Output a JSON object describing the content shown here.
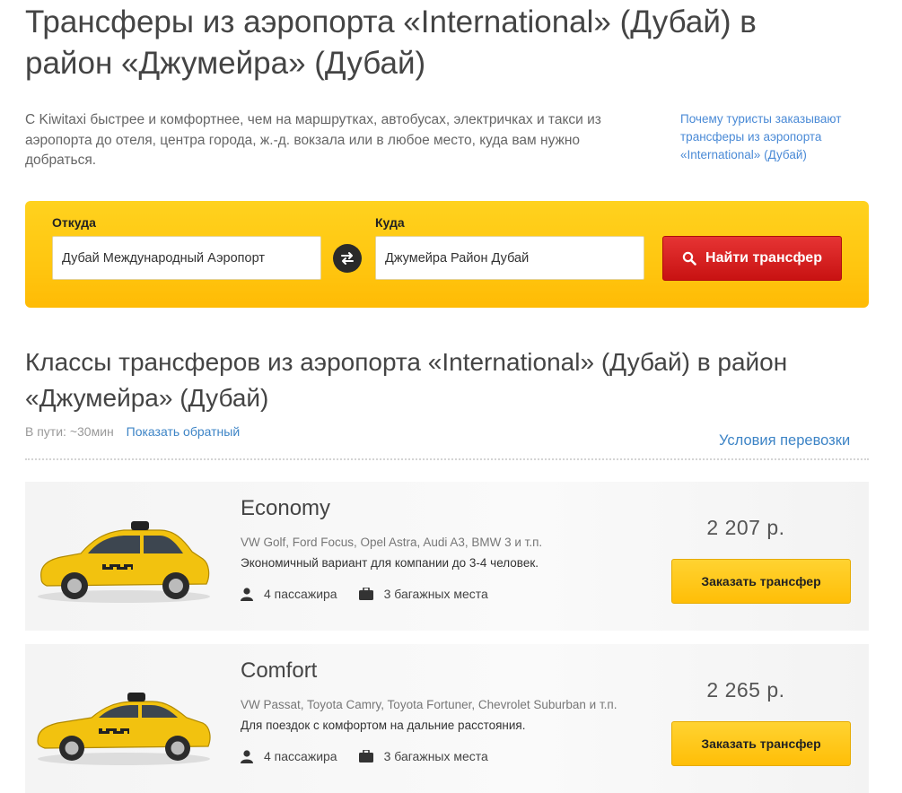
{
  "page": {
    "title": "Трансферы из аэропорта «International» (Дубай) в район «Джумейра» (Дубай)",
    "intro": "С Kiwitaxi быстрее и комфортнее, чем на маршрутках, автобусах, электричках и такси из аэропорта до отеля, центра города, ж.-д. вокзала или в любое место, куда вам нужно добраться.",
    "why_link": "Почему туристы заказывают трансферы из аэропорта «International» (Дубай)"
  },
  "search": {
    "from_label": "Откуда",
    "from_value": "Дубай Международный Аэропорт",
    "to_label": "Куда",
    "to_value": "Джумейра Район Дубай",
    "button_label": "Найти трансфер",
    "swap_icon": "swap-arrows-icon",
    "search_icon": "search-icon",
    "panel_color": "#ffc610",
    "button_color": "#d41f1f"
  },
  "classes_section": {
    "title": "Классы трансферов из аэропорта «International» (Дубай) в район «Джумейра» (Дубай)",
    "travel_time": "В пути: ~30мин",
    "reverse_link": "Показать обратный",
    "conditions_link": "Условия перевозки"
  },
  "classes": [
    {
      "name": "Economy",
      "models": "VW Golf, Ford Focus, Opel Astra, Audi A3, BMW 3 и т.п.",
      "description": "Экономичный вариант для компании до 3-4 человек.",
      "passengers": "4 пассажира",
      "luggage": "3 багажных места",
      "price": "2 207  р.",
      "button": "Заказать трансфер",
      "car_icon": "hatchback-taxi-image"
    },
    {
      "name": "Comfort",
      "models": "VW Passat, Toyota Camry, Toyota Fortuner, Chevrolet Suburban и т.п.",
      "description": "Для поездок с комфортом на дальние расстояния.",
      "passengers": "4 пассажира",
      "luggage": "3 багажных места",
      "price": "2 265  р.",
      "button": "Заказать трансфер",
      "car_icon": "sedan-taxi-image"
    }
  ],
  "colors": {
    "link": "#3d84c6",
    "order_button": "#ffc20e",
    "taxi_yellow": "#f2c20f"
  }
}
